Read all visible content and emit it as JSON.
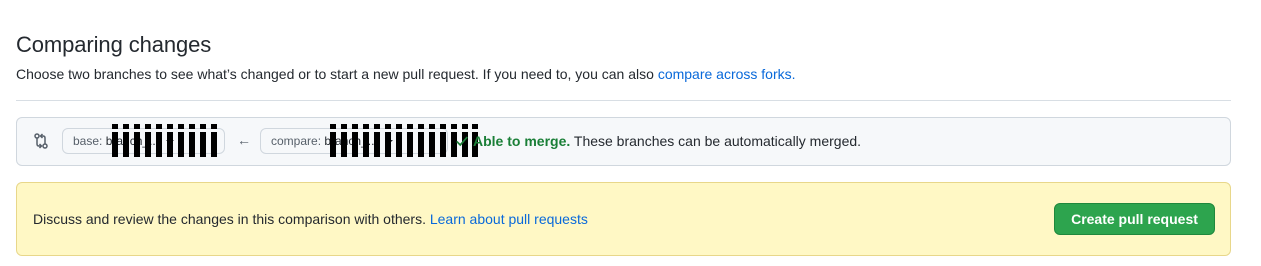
{
  "header": {
    "title": "Comparing changes",
    "subtitle": "Choose two branches to see what’s changed or to start a new pull request. If you need to, you can also ",
    "compare_forks_link": "compare across forks.",
    "subtitle_end": ""
  },
  "range": {
    "base_label": "base:",
    "base_value": "branch_...",
    "compare_label": "compare:",
    "compare_value": "branch_...",
    "merge_status": "Able to merge.",
    "merge_message": " These branches can be automatically merged."
  },
  "pull_request": {
    "discuss_text": "Discuss and review the changes in this comparison with others. ",
    "learn_link": "Learn about pull requests",
    "create_button": "Create pull request"
  },
  "colors": {
    "link": "#0969da",
    "success": "#1a7f37",
    "primary_button": "#2da44e",
    "notice_bg": "#fff8c5"
  },
  "icons": {
    "compare": "git-compare-icon",
    "arrow": "arrow-left-icon",
    "check": "check-icon"
  }
}
